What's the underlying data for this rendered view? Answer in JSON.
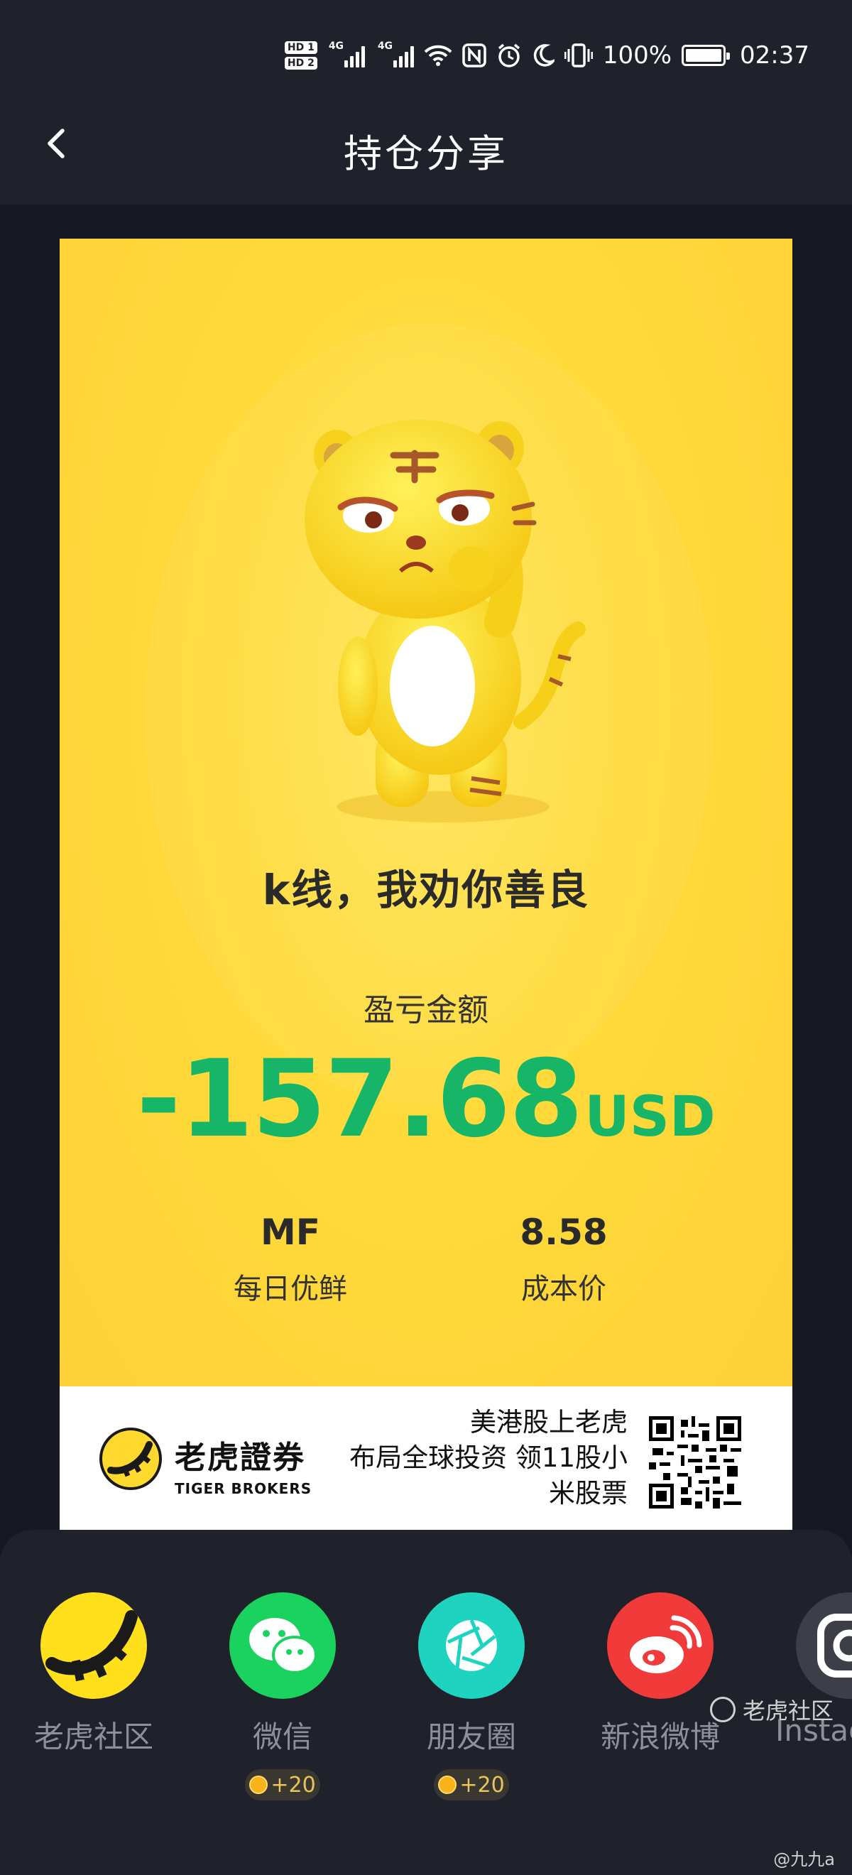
{
  "status_bar": {
    "hd1": "HD 1",
    "hd2": "HD 2",
    "net1": "4G",
    "net2": "4G",
    "battery": "100%",
    "time": "02:37",
    "icons": [
      "wifi-icon",
      "nfc-icon",
      "alarm-icon",
      "moon-icon",
      "vibrate-icon",
      "battery-icon"
    ]
  },
  "header": {
    "title": "持仓分享",
    "back_icon": "chevron-left-icon"
  },
  "card": {
    "slogan": "k线，我劝你善良",
    "pl_label": "盈亏金额",
    "pl_value": "-157.68",
    "pl_currency": "USD",
    "stats": [
      {
        "value": "MF",
        "label": "每日优鲜"
      },
      {
        "value": "8.58",
        "label": "成本价"
      }
    ],
    "colors": {
      "loss": "#16b567",
      "card": "#ffd93a"
    }
  },
  "promo": {
    "brand_cn": "老虎證券",
    "brand_en": "TIGER BROKERS",
    "line1": "美港股上老虎",
    "line2": "布局全球投资 领11股小",
    "line3": "米股票"
  },
  "share": {
    "items": [
      {
        "label": "老虎社区",
        "icon": "tiger-community-icon",
        "color": "#ffe01b",
        "bonus": ""
      },
      {
        "label": "微信",
        "icon": "wechat-icon",
        "color": "#19d35e",
        "bonus": "+20"
      },
      {
        "label": "朋友圈",
        "icon": "moments-icon",
        "color": "#1ed3bf",
        "bonus": "+20"
      },
      {
        "label": "新浪微博",
        "icon": "weibo-icon",
        "color": "#f13b3b",
        "bonus": ""
      },
      {
        "label": "Instag",
        "icon": "instagram-icon",
        "color": "#3c3e48",
        "bonus": ""
      }
    ]
  },
  "watermark": {
    "text": "老虎社区",
    "sub": "@九九a"
  }
}
